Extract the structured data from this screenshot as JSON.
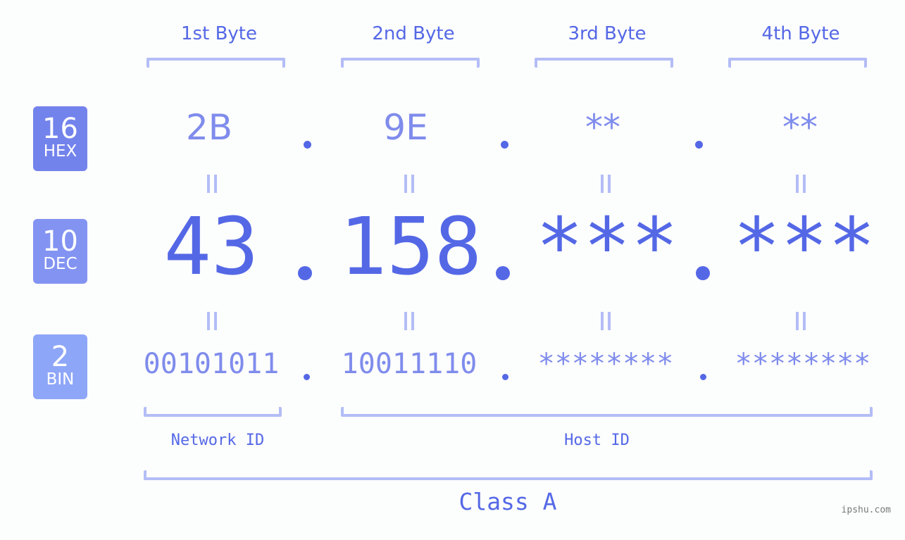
{
  "colors": {
    "accent": "#5468e6",
    "muted_value": "#7f8cec",
    "bracket": "#b3bdf6",
    "hex_badge": "#7383ec",
    "dec_badge": "#8293f2",
    "bin_badge": "#8ea6f8",
    "background": "#fcfdfd"
  },
  "byte_headers": [
    "1st Byte",
    "2nd Byte",
    "3rd Byte",
    "4th Byte"
  ],
  "rows": {
    "hex": {
      "badge_number": "16",
      "badge_label": "HEX",
      "octets": [
        "2B",
        "9E",
        "**",
        "**"
      ]
    },
    "dec": {
      "badge_number": "10",
      "badge_label": "DEC",
      "octets": [
        "43",
        "158",
        "***",
        "***"
      ]
    },
    "bin": {
      "badge_number": "2",
      "badge_label": "BIN",
      "octets": [
        "00101011",
        "10011110",
        "********",
        "********"
      ]
    }
  },
  "segments": {
    "network_id": "Network ID",
    "host_id": "Host ID",
    "class": "Class A"
  },
  "watermark": "ipshu.com"
}
